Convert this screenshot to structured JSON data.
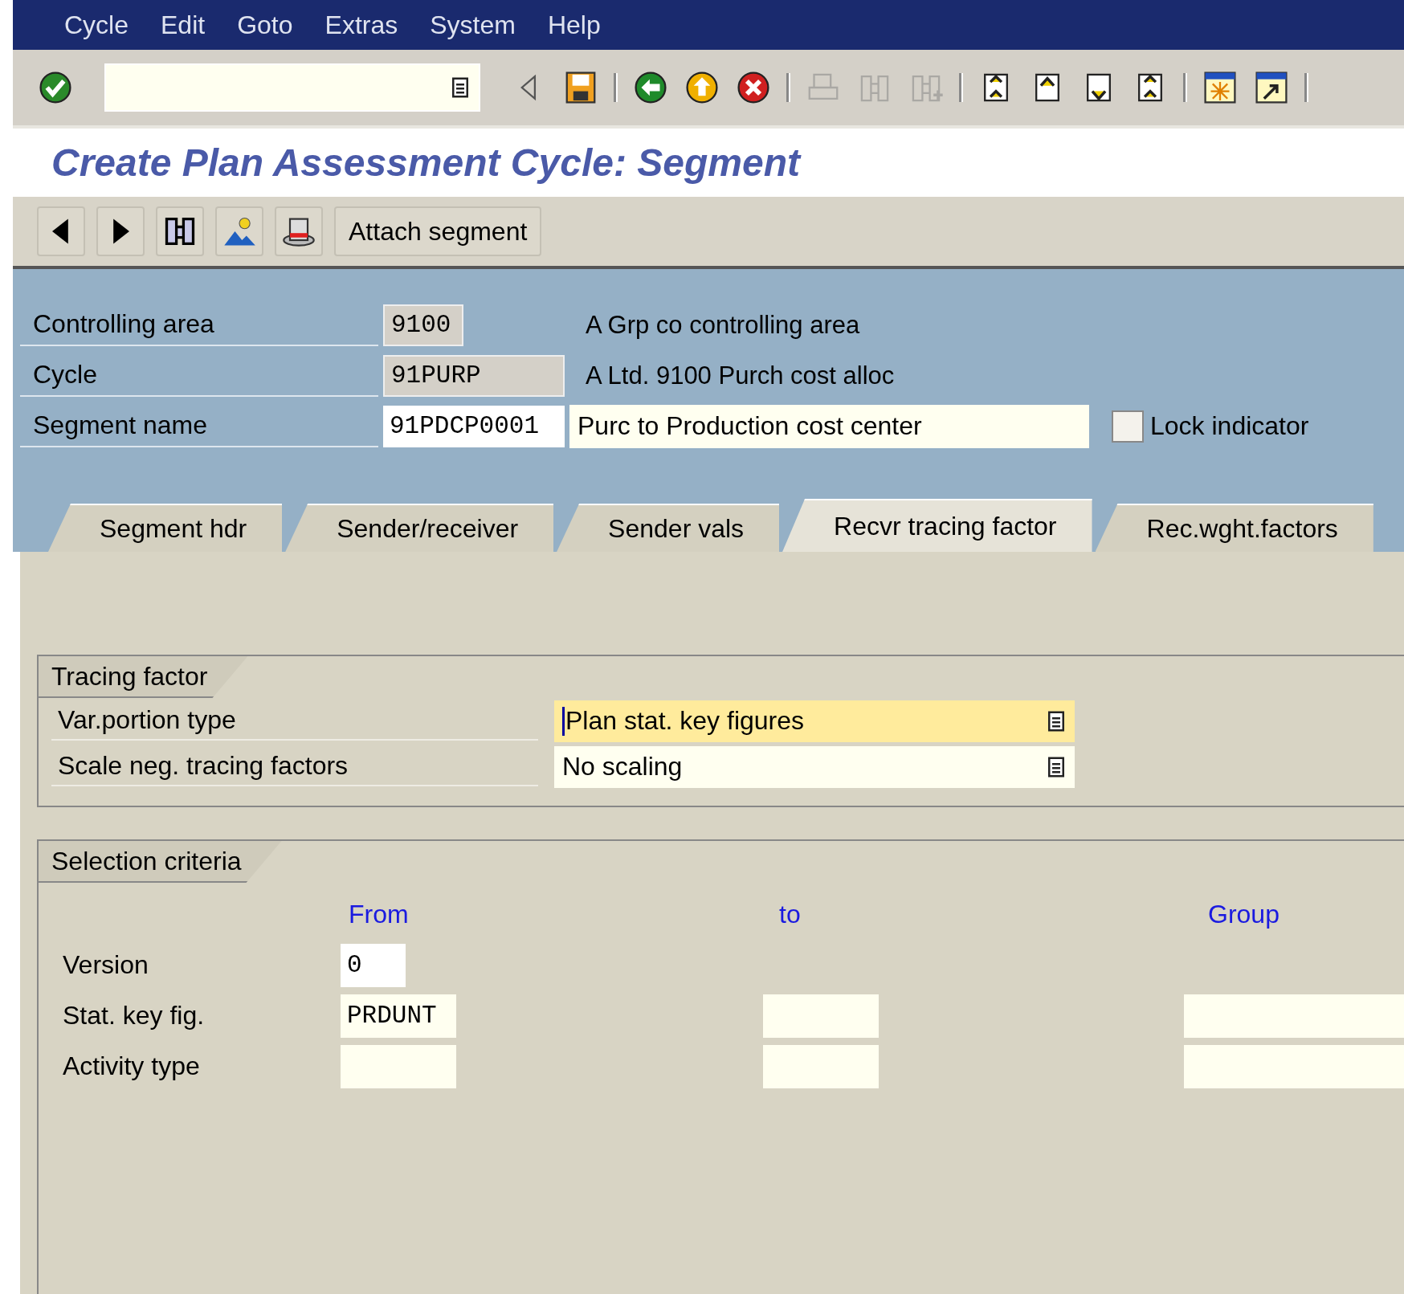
{
  "menu_bar": {
    "items": [
      "Cycle",
      "Edit",
      "Goto",
      "Extras",
      "System",
      "Help"
    ]
  },
  "toolbar": {
    "buttons": [
      {
        "kind": "enter",
        "disabled": false
      },
      {
        "kind": "field"
      },
      {
        "kind": "collapse",
        "disabled": false
      },
      {
        "kind": "save",
        "disabled": false
      },
      {
        "kind": "sep"
      },
      {
        "kind": "back",
        "disabled": false
      },
      {
        "kind": "exit",
        "disabled": false
      },
      {
        "kind": "cancel",
        "disabled": false
      },
      {
        "kind": "sep"
      },
      {
        "kind": "print",
        "disabled": true
      },
      {
        "kind": "find",
        "disabled": true
      },
      {
        "kind": "find-next",
        "disabled": true
      },
      {
        "kind": "sep"
      },
      {
        "kind": "first-page",
        "disabled": false
      },
      {
        "kind": "prev-page",
        "disabled": false
      },
      {
        "kind": "next-page",
        "disabled": false
      },
      {
        "kind": "last-page",
        "disabled": false
      },
      {
        "kind": "sep"
      },
      {
        "kind": "new-session",
        "disabled": false
      },
      {
        "kind": "shortcut",
        "disabled": false
      },
      {
        "kind": "sep"
      }
    ]
  },
  "title": "Create Plan Assessment Cycle: Segment",
  "app_toolbar": {
    "buttons": [
      {
        "kind": "previous"
      },
      {
        "kind": "next"
      },
      {
        "kind": "find"
      },
      {
        "kind": "landscape"
      },
      {
        "kind": "hat"
      },
      {
        "kind": "text",
        "label": "Attach segment"
      }
    ]
  },
  "header": {
    "rows": [
      {
        "label": "Controlling area",
        "value": "9100",
        "editable": false,
        "kind": "short",
        "description": {
          "kind": "text",
          "text": "A Grp co controlling area"
        }
      },
      {
        "label": "Cycle",
        "value": "91PURP",
        "editable": false,
        "kind": "long",
        "description": {
          "kind": "text",
          "text": "A Ltd. 9100 Purch cost alloc"
        }
      },
      {
        "label": "Segment name",
        "value": "91PDCP0001",
        "editable": true,
        "kind": "long",
        "description": {
          "kind": "field",
          "text": "Purc to Production cost center"
        },
        "checkbox": {
          "label": "Lock indicator",
          "checked": false
        }
      }
    ]
  },
  "tabs": [
    {
      "label": "Segment hdr",
      "selected": false
    },
    {
      "label": "Sender/receiver",
      "selected": false
    },
    {
      "label": "Sender vals",
      "selected": false
    },
    {
      "label": "Recvr tracing factor",
      "selected": true
    },
    {
      "label": "Rec.wght.factors",
      "selected": false
    }
  ],
  "tracing_factor": {
    "title": "Tracing factor",
    "rows": [
      {
        "label": "Var.portion type",
        "value": "Plan stat. key figures",
        "focused": true
      },
      {
        "label": "Scale neg. tracing factors",
        "value": "No scaling",
        "focused": false
      }
    ]
  },
  "selection_criteria": {
    "title": "Selection criteria",
    "columns": [
      "From",
      "to",
      "Group"
    ],
    "rows": [
      {
        "label": "Version",
        "from": "0",
        "short": true,
        "has_to": false,
        "has_group": false
      },
      {
        "label": "Stat. key fig.",
        "from": "PRDUNT",
        "short": false,
        "has_to": true,
        "has_group": true
      },
      {
        "label": "Activity type",
        "short": false,
        "has_to": true,
        "has_group": true
      }
    ]
  }
}
